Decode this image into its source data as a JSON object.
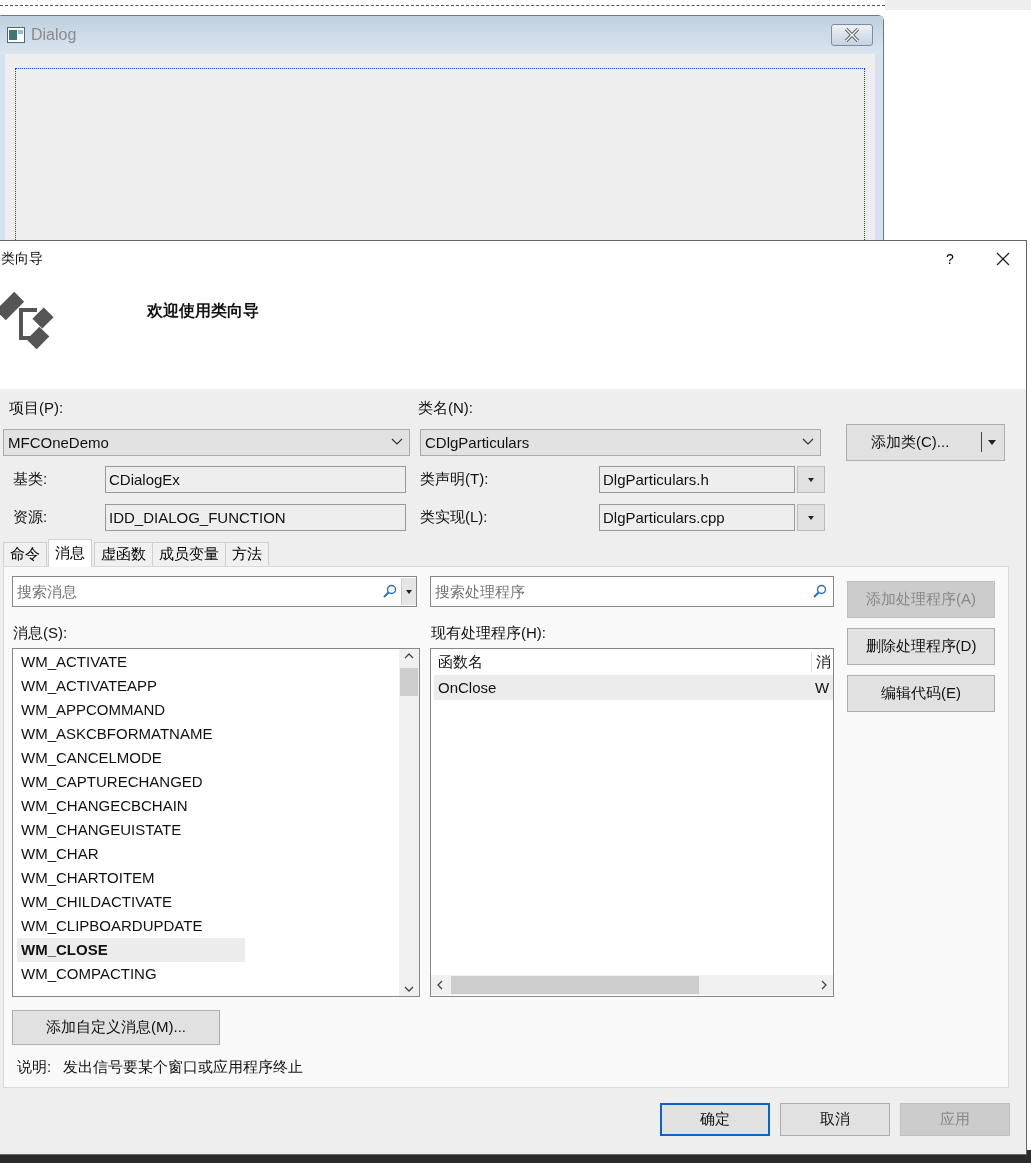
{
  "background_dialog": {
    "title": "Dialog"
  },
  "wizard": {
    "title": "类向导",
    "help": "?",
    "header_text": "欢迎使用类向导"
  },
  "project": {
    "label": "项目(P):",
    "value": "MFCOneDemo"
  },
  "class_name": {
    "label": "类名(N):",
    "value": "CDlgParticulars"
  },
  "add_class_button": "添加类(C)...",
  "base_class": {
    "label": "基类:",
    "value": "CDialogEx"
  },
  "resource": {
    "label": "资源:",
    "value": "IDD_DIALOG_FUNCTION"
  },
  "declaration": {
    "label": "类声明(T):",
    "value": "DlgParticulars.h"
  },
  "implementation": {
    "label": "类实现(L):",
    "value": "DlgParticulars.cpp"
  },
  "tabs": [
    {
      "label": "命令",
      "selected": false
    },
    {
      "label": "消息",
      "selected": true
    },
    {
      "label": "虚函数",
      "selected": false
    },
    {
      "label": "成员变量",
      "selected": false
    },
    {
      "label": "方法",
      "selected": false
    }
  ],
  "search_messages": {
    "placeholder": "搜索消息"
  },
  "search_handlers": {
    "placeholder": "搜索处理程序"
  },
  "messages_label": "消息(S):",
  "messages": [
    {
      "name": "WM_ACTIVATE",
      "selected": false
    },
    {
      "name": "WM_ACTIVATEAPP",
      "selected": false
    },
    {
      "name": "WM_APPCOMMAND",
      "selected": false
    },
    {
      "name": "WM_ASKCBFORMATNAME",
      "selected": false
    },
    {
      "name": "WM_CANCELMODE",
      "selected": false
    },
    {
      "name": "WM_CAPTURECHANGED",
      "selected": false
    },
    {
      "name": "WM_CHANGECBCHAIN",
      "selected": false
    },
    {
      "name": "WM_CHANGEUISTATE",
      "selected": false
    },
    {
      "name": "WM_CHAR",
      "selected": false
    },
    {
      "name": "WM_CHARTOITEM",
      "selected": false
    },
    {
      "name": "WM_CHILDACTIVATE",
      "selected": false
    },
    {
      "name": "WM_CLIPBOARDUPDATE",
      "selected": false
    },
    {
      "name": "WM_CLOSE",
      "selected": true
    },
    {
      "name": "WM_COMPACTING",
      "selected": false
    }
  ],
  "handlers_label": "现有处理程序(H):",
  "handler_table": {
    "columns": [
      "函数名",
      "消"
    ],
    "rows": [
      {
        "cells": [
          "OnClose",
          "W"
        ],
        "selected": true
      }
    ]
  },
  "side_buttons": [
    {
      "label": "添加处理程序(A)",
      "disabled": true
    },
    {
      "label": "删除处理程序(D)",
      "disabled": false
    },
    {
      "label": "编辑代码(E)",
      "disabled": false
    }
  ],
  "custom_message_button": "添加自定义消息(M)...",
  "description": {
    "label": "说明:",
    "text": "发出信号要某个窗口或应用程序终止"
  },
  "footer_buttons": [
    {
      "label": "确定",
      "default": true,
      "disabled": false
    },
    {
      "label": "取消",
      "default": false,
      "disabled": false
    },
    {
      "label": "应用",
      "default": false,
      "disabled": true
    }
  ]
}
